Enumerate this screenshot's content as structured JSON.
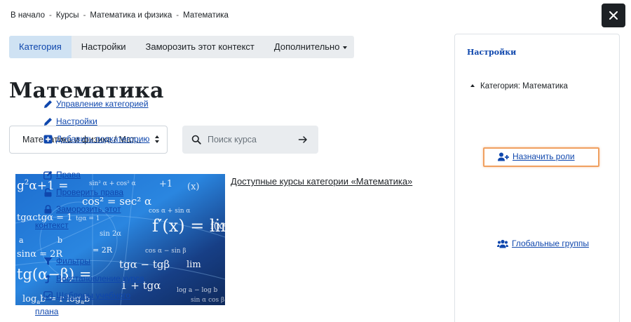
{
  "breadcrumb": [
    "В начало",
    "Курсы",
    "Математика и физика",
    "Математика"
  ],
  "tabs": [
    {
      "label": "Категория",
      "active": true
    },
    {
      "label": "Настройки"
    },
    {
      "label": "Заморозить этот контекст"
    },
    {
      "label": "Дополнительно"
    }
  ],
  "page_title": "Математика",
  "category_select": {
    "value": "Математика и физика / Мат..."
  },
  "search": {
    "placeholder": "Поиск курса"
  },
  "course": {
    "link_text": "Доступные курсы категории «Математика»",
    "image": "math-formulas-image"
  },
  "settings_block": {
    "title": "Настройки",
    "root": "Категория: Математика",
    "items": [
      {
        "label": "Управление категорией",
        "icon": "pencil-icon"
      },
      {
        "label": "Настройки",
        "icon": "pencil-icon"
      },
      {
        "label": "Добавить подкатегорию",
        "icon": "plus-square-icon"
      },
      {
        "label": "Назначить роли",
        "icon": "user-plus-icon",
        "highlighted": true
      },
      {
        "label": "Права",
        "icon": "edit-square-icon"
      },
      {
        "label": "Проверить права",
        "icon": "unlock-icon"
      },
      {
        "label": "Заморозить этот",
        "label_cont": "контекст",
        "icon": "lock-icon"
      },
      {
        "label": "Глобальные группы",
        "icon": "users-icon"
      },
      {
        "label": "Фильтры",
        "icon": "filter-icon"
      },
      {
        "label": "Восстановление курса",
        "icon": "level-up-icon"
      },
      {
        "label": "Шаблоны учебного",
        "label_cont": "плана",
        "icon": "check-square-icon"
      }
    ]
  },
  "colors": {
    "link": "#0f47ad",
    "active_tab_bg": "#cfe2f3",
    "tabs_bg": "#e9ecef",
    "highlight_border": "#f0a060",
    "close_bg": "#1d2125"
  }
}
